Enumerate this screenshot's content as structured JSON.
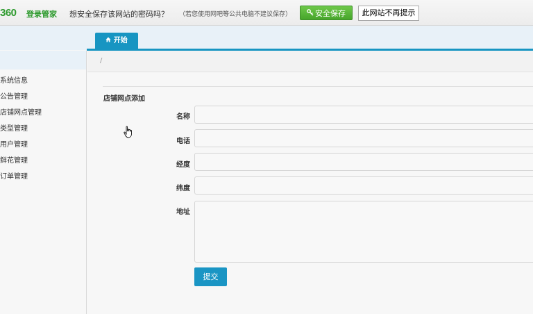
{
  "password_bar": {
    "logo": "360",
    "logo_text": "登录管家",
    "question": "想安全保存该网站的密码吗？",
    "tip": "（若您使用网吧等公共电脑不建议保存）",
    "save_label": "安全保存",
    "never_label": "此网站不再提示"
  },
  "tabs": {
    "start": "开始"
  },
  "breadcrumb": {
    "separator": "/"
  },
  "sidebar": {
    "items": [
      "系统信息",
      "公告管理",
      "店铺网点管理",
      "类型管理",
      "用户管理",
      "鲜花管理",
      "订单管理"
    ]
  },
  "form": {
    "title": "店铺网点添加",
    "fields": [
      {
        "label": "名称",
        "value": ""
      },
      {
        "label": "电话",
        "value": ""
      },
      {
        "label": "经度",
        "value": ""
      },
      {
        "label": "纬度",
        "value": ""
      },
      {
        "label": "地址",
        "value": ""
      }
    ],
    "submit_label": "提交"
  },
  "colors": {
    "accent": "#1795c2",
    "save_green": "#47a52b",
    "logo_green": "#2d9a2d"
  }
}
